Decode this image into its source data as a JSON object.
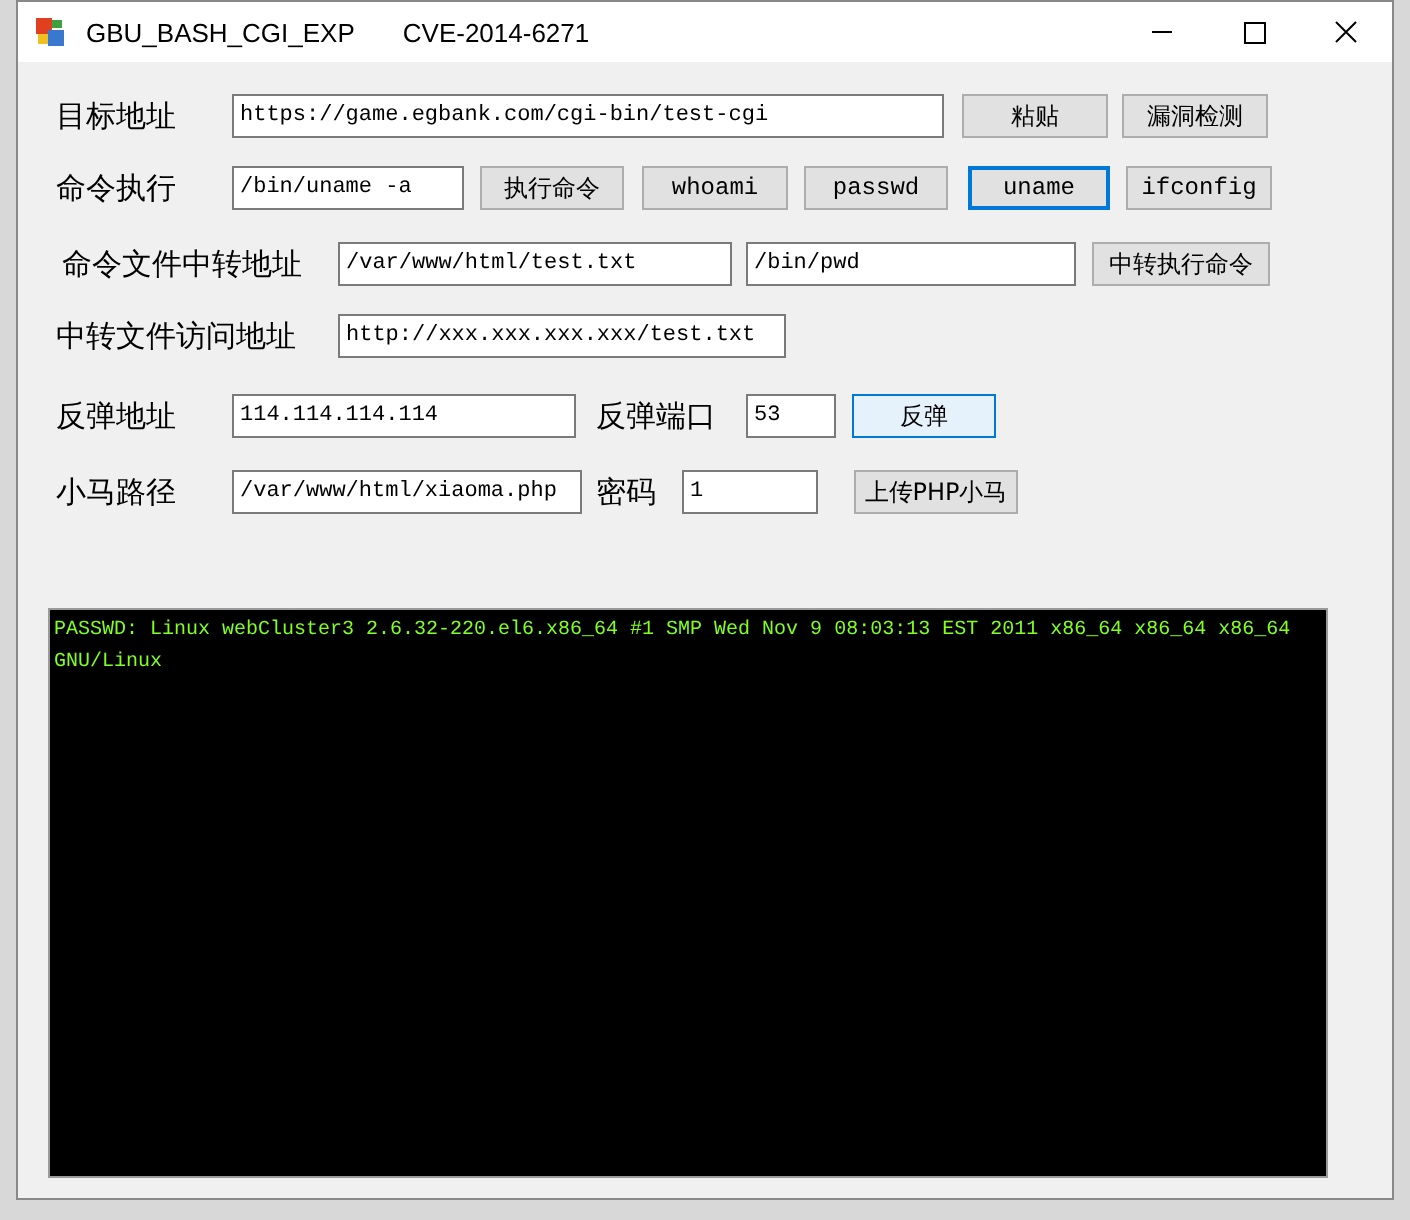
{
  "window": {
    "title": "GBU_BASH_CGI_EXP",
    "subtitle": "CVE-2014-6271"
  },
  "rows": [
    {
      "items": [
        {
          "kind": "label",
          "text": "目标地址"
        },
        {
          "kind": "input",
          "value": "https://game.egbank.com/cgi-bin/test-cgi"
        },
        {
          "kind": "button",
          "text": "粘贴",
          "focused": false,
          "hovered": false
        },
        {
          "kind": "button",
          "text": "漏洞检测",
          "focused": false,
          "hovered": false
        }
      ]
    },
    {
      "items": [
        {
          "kind": "label",
          "text": "命令执行"
        },
        {
          "kind": "input",
          "value": "/bin/uname -a"
        },
        {
          "kind": "button",
          "text": "执行命令",
          "focused": false,
          "hovered": false
        },
        {
          "kind": "button",
          "text": "whoami",
          "focused": false,
          "hovered": false
        },
        {
          "kind": "button",
          "text": "passwd",
          "focused": false,
          "hovered": false
        },
        {
          "kind": "button",
          "text": "uname",
          "focused": true,
          "hovered": false
        },
        {
          "kind": "button",
          "text": "ifconfig",
          "focused": false,
          "hovered": false
        }
      ]
    },
    {
      "items": [
        {
          "kind": "label",
          "text": "命令文件中转地址"
        },
        {
          "kind": "input",
          "value": "/var/www/html/test.txt"
        },
        {
          "kind": "input",
          "value": "/bin/pwd"
        },
        {
          "kind": "button",
          "text": "中转执行命令",
          "focused": false,
          "hovered": false
        }
      ]
    },
    {
      "items": [
        {
          "kind": "label",
          "text": "中转文件访问地址"
        },
        {
          "kind": "input",
          "value": "http://xxx.xxx.xxx.xxx/test.txt"
        }
      ]
    },
    {
      "items": [
        {
          "kind": "label",
          "text": "反弹地址"
        },
        {
          "kind": "input",
          "value": "114.114.114.114"
        },
        {
          "kind": "label",
          "text": "反弹端口"
        },
        {
          "kind": "input",
          "value": "53"
        },
        {
          "kind": "button",
          "text": "反弹",
          "focused": false,
          "hovered": true
        }
      ]
    },
    {
      "items": [
        {
          "kind": "label",
          "text": "小马路径"
        },
        {
          "kind": "input",
          "value": "/var/www/html/xiaoma.php"
        },
        {
          "kind": "label",
          "text": "密码"
        },
        {
          "kind": "input",
          "value": "1"
        },
        {
          "kind": "button",
          "text": "上传PHP小马",
          "focused": false,
          "hovered": false
        }
      ]
    }
  ],
  "console": {
    "lines": [
      "PASSWD: Linux webCluster3 2.6.32-220.el6.x86_64 #1 SMP Wed Nov 9 08:03:13 EST 2011 x86_64 x86_64 x86_64",
      "GNU/Linux"
    ]
  }
}
